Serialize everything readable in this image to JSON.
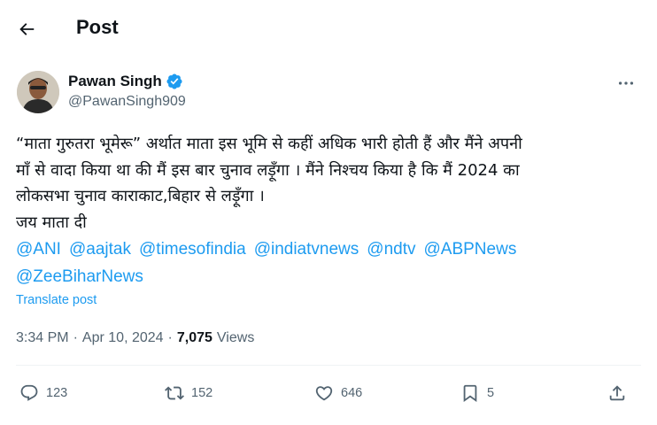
{
  "header": {
    "title": "Post"
  },
  "author": {
    "name": "Pawan Singh",
    "handle": "@PawanSingh909",
    "verified": true
  },
  "post": {
    "lines": [
      "“माता गुरुतरा भूमेरू” अर्थात माता इस भूमि से कहीं अधिक भारी होती हैं और मैंने अपनी",
      "माँ से वादा किया था की मैं इस बार चुनाव लड़ूँगा । मैंने निश्चय किया है कि मैं 2024 का",
      "लोकसभा चुनाव काराकाट,बिहार से लड़ूँगा ।",
      "जय माता दी"
    ],
    "mentions": [
      "@ANI",
      "@aajtak",
      "@timesofindia",
      "@indiatvnews",
      "@ndtv",
      "@ABPNews",
      "@ZeeBiharNews"
    ],
    "translate_label": "Translate post"
  },
  "meta": {
    "time": "3:34 PM",
    "separator": "·",
    "date": "Apr 10, 2024",
    "views_count": "7,075",
    "views_label": "Views"
  },
  "actions": {
    "replies": "123",
    "reposts": "152",
    "likes": "646",
    "bookmarks": "5"
  },
  "icons": {
    "back": "arrow-left-icon",
    "verified": "verified-badge-icon",
    "more": "more-horizontal-icon",
    "reply": "reply-icon",
    "repost": "repost-icon",
    "like": "heart-icon",
    "bookmark": "bookmark-icon",
    "share": "share-icon"
  },
  "colors": {
    "accent": "#1d9bf0",
    "text": "#0f1419",
    "secondary": "#536471",
    "divider": "#eff3f4"
  }
}
